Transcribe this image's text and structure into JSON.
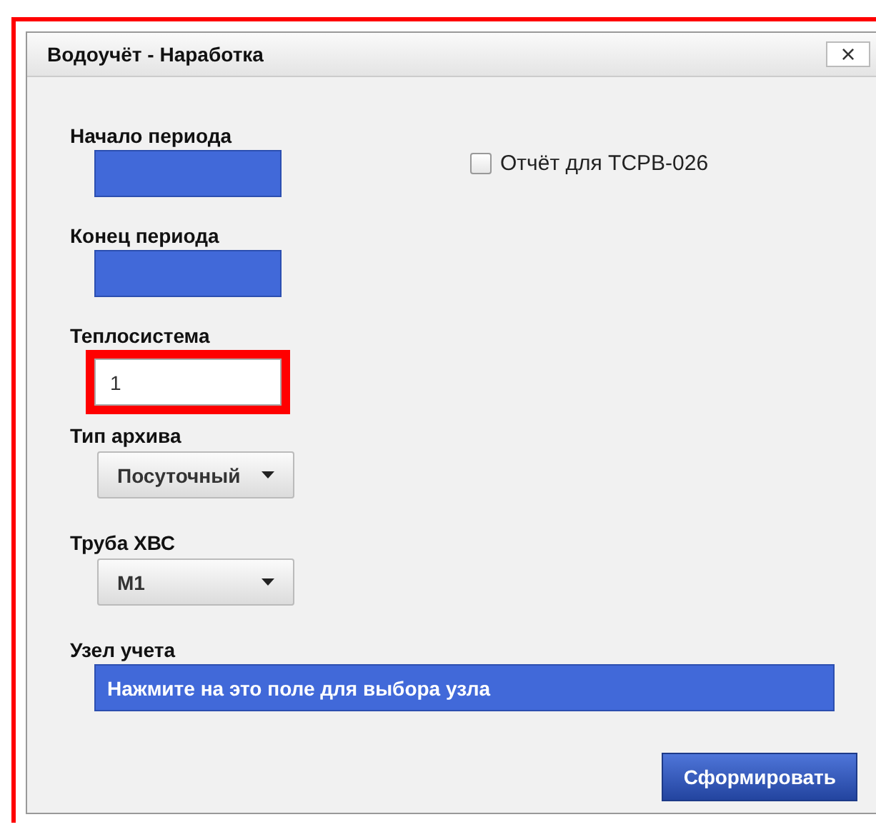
{
  "window": {
    "title": "Водоучёт - Наработка",
    "close": "×"
  },
  "fields": [
    {
      "kind": "date",
      "label": "Начало периода",
      "highlighted": false
    },
    {
      "kind": "date",
      "label": "Конец периода",
      "highlighted": false
    },
    {
      "kind": "text",
      "label": "Теплосистема",
      "value": "1",
      "highlighted": true
    },
    {
      "kind": "select",
      "label": "Тип архива",
      "value": "Посуточный",
      "highlighted": false
    },
    {
      "kind": "select",
      "label": "Труба ХВС",
      "value": "М1",
      "highlighted": false
    },
    {
      "kind": "node",
      "label": "Узел учета",
      "value": "Нажмите на это поле для выбора узла",
      "highlighted": false
    }
  ],
  "checkbox": {
    "label": "Отчёт для ТСРВ-026",
    "checked": false
  },
  "buttons": [
    "Сформировать"
  ]
}
